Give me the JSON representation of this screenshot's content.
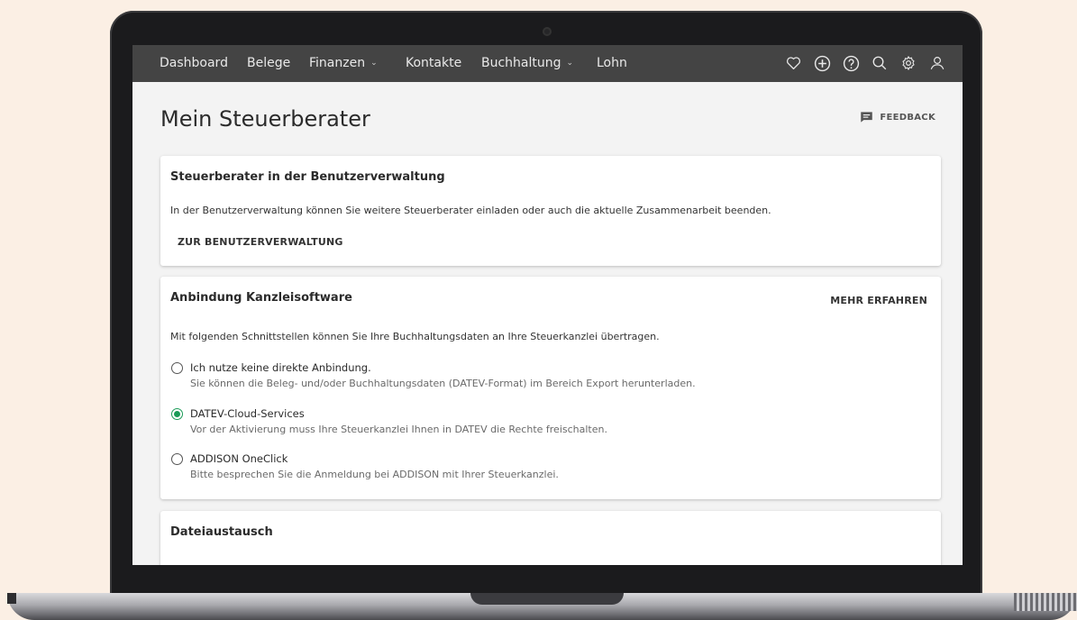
{
  "nav": {
    "items": [
      {
        "label": "Dashboard"
      },
      {
        "label": "Belege"
      },
      {
        "label": "Finanzen",
        "dropdown": true
      },
      {
        "label": "Kontakte"
      },
      {
        "label": "Buchhaltung",
        "dropdown": true
      },
      {
        "label": "Lohn"
      }
    ],
    "icons": [
      "heart-icon",
      "plus-circle-icon",
      "help-icon",
      "search-icon",
      "gear-icon",
      "user-icon"
    ]
  },
  "page": {
    "title": "Mein Steuerberater",
    "feedback_label": "FEEDBACK"
  },
  "card1": {
    "title": "Steuerberater in der Benutzerverwaltung",
    "text": "In der Benutzerverwaltung können Sie weitere Steuerberater einladen oder auch die aktuelle Zusammenarbeit beenden.",
    "button": "ZUR BENUTZERVERWALTUNG"
  },
  "card2": {
    "title": "Anbindung Kanzleisoftware",
    "more": "MEHR ERFAHREN",
    "intro": "Mit folgenden Schnittstellen können Sie Ihre Buchhaltungsdaten an Ihre Steuerkanzlei übertragen.",
    "options": [
      {
        "label": "Ich nutze keine direkte Anbindung.",
        "desc": "Sie können die Beleg- und/oder Buchhaltungsdaten (DATEV-Format) im Bereich Export herunterladen.",
        "checked": false
      },
      {
        "label": "DATEV-Cloud-Services",
        "desc": "Vor der Aktivierung muss Ihre Steuerkanzlei Ihnen in DATEV die Rechte freischalten.",
        "checked": true
      },
      {
        "label": "ADDISON OneClick",
        "desc": "Bitte besprechen Sie die Anmeldung bei ADDISON mit Ihrer Steuerkanzlei.",
        "checked": false
      }
    ]
  },
  "card3": {
    "title": "Dateiaustausch"
  },
  "colors": {
    "accent": "#1a9b57",
    "navbar": "#444444",
    "background": "#fbefe4"
  }
}
